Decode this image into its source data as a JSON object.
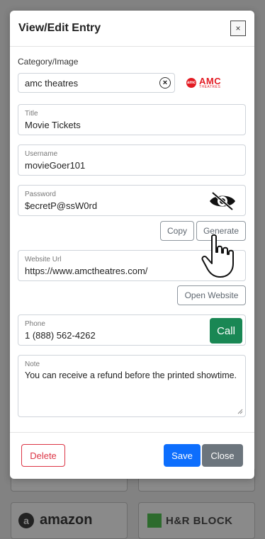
{
  "modal": {
    "title": "View/Edit Entry",
    "close_symbol": "×"
  },
  "category": {
    "label": "Category/Image",
    "value": "amc theatres",
    "clear_icon": "clear-circle-icon",
    "logo_text": "AMC",
    "logo_sub": "THEATRES",
    "logo_badge": "amc"
  },
  "fields": {
    "title": {
      "label": "Title",
      "value": "Movie Tickets"
    },
    "username": {
      "label": "Username",
      "value": "movieGoer101"
    },
    "password": {
      "label": "Password",
      "value": "$ecretP@ssW0rd",
      "toggle_icon": "eye-slash-icon"
    },
    "website": {
      "label": "Website Url",
      "value": "https://www.amctheatres.com/"
    },
    "phone": {
      "label": "Phone",
      "value": "1 (888) 562-4262"
    },
    "note": {
      "label": "Note",
      "value": "You can receive a refund before the printed showtime."
    }
  },
  "buttons": {
    "copy": "Copy",
    "generate": "Generate",
    "open_website": "Open Website",
    "call": "Call",
    "delete": "Delete",
    "save": "Save",
    "close": "Close"
  },
  "background": {
    "amazon": "amazon",
    "hrblock": "H&R BLOCK"
  },
  "colors": {
    "primary": "#0d6efd",
    "danger": "#dc3545",
    "success": "#198754",
    "secondary": "#6c757d",
    "amc_red": "#e31b23"
  }
}
